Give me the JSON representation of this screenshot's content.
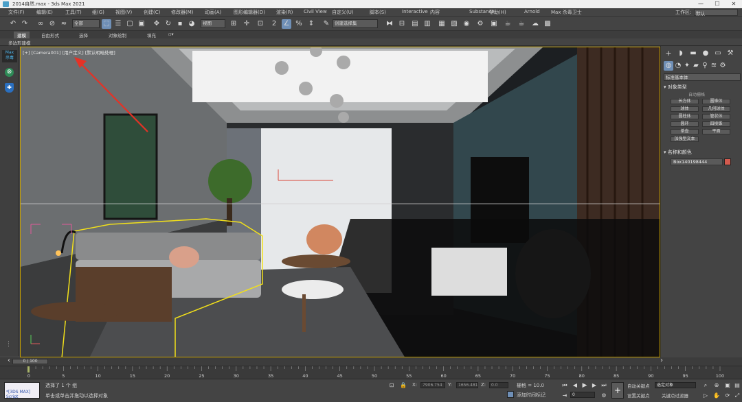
{
  "window": {
    "title": "2014自然.max - 3ds Max 2021"
  },
  "menubar": {
    "items": [
      "文件(F)",
      "编辑(E)",
      "工具(T)",
      "组(G)",
      "视图(V)",
      "创建(C)",
      "修改器(M)",
      "动画(A)",
      "图形编辑器(D)",
      "渲染(R)",
      "Civil View",
      "自定义(U)",
      "脚本(S)",
      "Interactive",
      "内容",
      "Substance",
      "帮助(H)",
      "Arnold",
      "Max 杀毒卫士"
    ],
    "workspace_label": "工作区:",
    "workspace_value": "默认"
  },
  "toolbar": {
    "filter_value": "全部",
    "refcoord_value": "视图",
    "selset_value": "创建选择集"
  },
  "ribbon": {
    "tabs": [
      "建模",
      "自由形式",
      "选择",
      "对象绘制",
      "填充"
    ],
    "sub_label": "多边形建模"
  },
  "leftstrip": {
    "max_label": "Max",
    "antivirus_label": "杀毒"
  },
  "viewport": {
    "label": "[+] [Camera001] [用户定义] [默认明暗处理]",
    "accent_border": "#c8a200",
    "selection_color": "#f2e01a"
  },
  "command_panel": {
    "dropdown": "标准基本体",
    "section_object_type": "对象类型",
    "autogrid": "自动栅格",
    "buttons": [
      "长方体",
      "圆锥体",
      "球体",
      "几何球体",
      "圆柱体",
      "管状体",
      "圆环",
      "四棱锥",
      "茶壶",
      "平面",
      "加强型文本"
    ],
    "section_name_color": "名称和颜色",
    "object_name": "Box140198444",
    "object_color": "#d25a4e"
  },
  "timeline": {
    "frame_display": "0 / 100"
  },
  "trackbar": {
    "ticks": [
      "0",
      "5",
      "10",
      "15",
      "20",
      "25",
      "30",
      "35",
      "40",
      "45",
      "50",
      "55",
      "60",
      "65",
      "70",
      "75",
      "80",
      "85",
      "90",
      "95",
      "100"
    ]
  },
  "status": {
    "maxscript": "*[3DS MAX] Script",
    "selected": "选择了 1 个 组",
    "hint": "单击或单击并拖动以选择对象",
    "x_label": "X:",
    "x_value": "7906.754",
    "y_label": "Y:",
    "y_value": "1656.481",
    "z_label": "Z:",
    "z_value": "0.0",
    "grid": "栅格 = 10.0",
    "add_time_tag": "添加时间标记",
    "autokey": "自动关键点",
    "selected_obj": "选定对象",
    "set_key": "设置关键点",
    "key_filters": "关键点过滤器",
    "frame_value": "0"
  }
}
